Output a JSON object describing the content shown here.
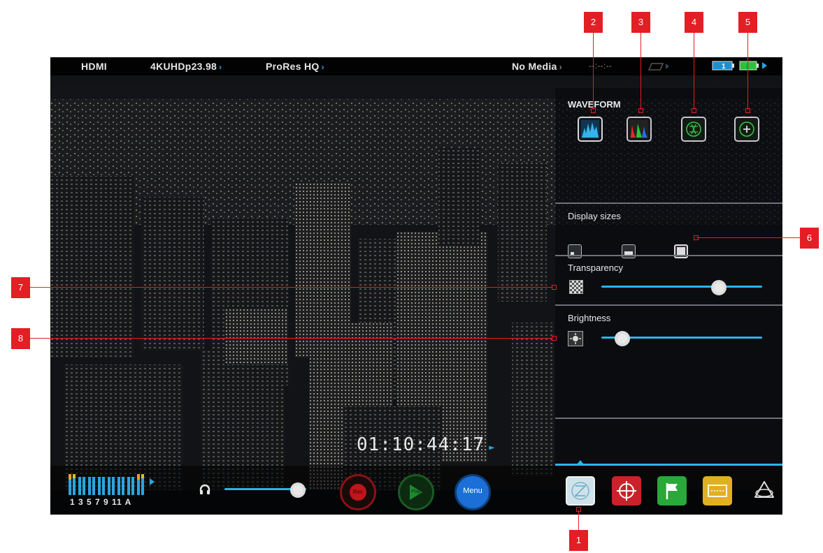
{
  "status_bar": {
    "input": "HDMI",
    "format": "4KUHDp23.98",
    "codec": "ProRes HQ",
    "media": "No Media",
    "timecode_remaining": "--:--:--",
    "battery1_label": "1",
    "chevron": "›"
  },
  "waveform_panel": {
    "title": "WAVEFORM",
    "buttons": [
      "luma-waveform-icon",
      "rgb-parade-icon",
      "vectorscope-icon",
      "false-color-icon"
    ],
    "display_sizes_label": "Display sizes",
    "transparency_label": "Transparency",
    "transparency_level": 0.73,
    "brightness_label": "Brightness",
    "brightness_level": 0.13
  },
  "timecode": "01:10:44:17",
  "bottom_bar": {
    "meter_channels": "1 3 5 7 9 11 A",
    "headphone_volume": 0.9,
    "rec_label": "Rec",
    "play_label": "Play",
    "menu_label": "Menu",
    "tools": [
      "waveform-tool-icon",
      "focus-peaking-icon",
      "flag-icon",
      "frame-guides-icon",
      "atomos-logo-icon"
    ]
  },
  "callouts": [
    "1",
    "2",
    "3",
    "4",
    "5",
    "6",
    "7",
    "8"
  ],
  "colors": {
    "accent": "#2bb5e6",
    "callout": "#e31e24",
    "rec": "#c0161b",
    "play": "#1e8a2e",
    "menu": "#1b6fd6"
  }
}
